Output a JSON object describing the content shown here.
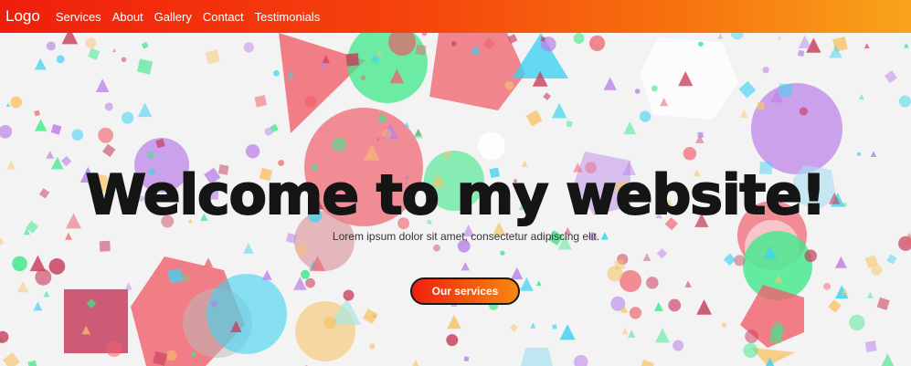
{
  "nav": {
    "logo": "Logo",
    "links": [
      "Services",
      "About",
      "Gallery",
      "Contact",
      "Testimonials"
    ]
  },
  "hero": {
    "title": "Welcome to my website!",
    "subtitle": "Lorem ipsum dolor sit amet, consectetur adipiscing elit.",
    "cta_label": "Our services"
  },
  "colors": {
    "nav_gradient_start": "#f01e0c",
    "nav_gradient_end": "#f9a41a",
    "shape_red": "#f0606c",
    "shape_green": "#3ee88a",
    "shape_cyan": "#3fd3f0",
    "shape_purple": "#b97ee8",
    "shape_orange": "#f7c46a"
  }
}
